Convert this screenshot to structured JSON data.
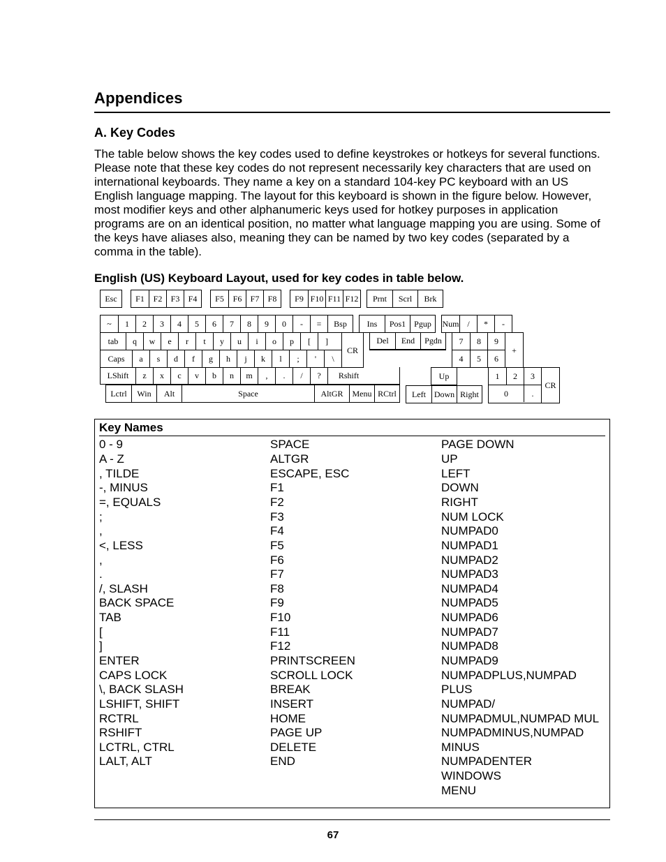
{
  "headings": {
    "appendices": "Appendices",
    "section_a": "A. Key Codes"
  },
  "intro": "The table below shows the key codes used to define keystrokes or hotkeys for several functions. Please note that these key codes do not represent necessarily key characters that are used on international keyboards. They name a key on a standard 104-key PC keyboard with an US English language mapping. The layout for this keyboard is shown in the figure below. However, most modifier keys and other alphanumeric keys used for hotkey purposes in application programs are on an identical position, no matter what language mapping you are using. Some of the keys have aliases also, meaning they can be named by two key codes (separated by a comma in the table).",
  "caption": "English (US) Keyboard Layout, used for key codes in table below.",
  "keyboard": {
    "row_fn_a": [
      "Esc"
    ],
    "row_fn_b": [
      "F1",
      "F2",
      "F3",
      "F4"
    ],
    "row_fn_c": [
      "F5",
      "F6",
      "F7",
      "F8"
    ],
    "row_fn_d": [
      "F9",
      "F10",
      "F11",
      "F12"
    ],
    "row_fn_e": [
      "Prnt",
      "Scrl",
      "Brk"
    ],
    "row_num_main": [
      "~",
      "1",
      "2",
      "3",
      "4",
      "5",
      "6",
      "7",
      "8",
      "9",
      "0",
      "-",
      "=",
      "Bsp"
    ],
    "row_num_nav": [
      "Ins",
      "Pos1",
      "Pgup"
    ],
    "row_num_npA": [
      "Num",
      "/",
      "*",
      "-"
    ],
    "row_q_main": [
      "tab",
      "q",
      "w",
      "e",
      "r",
      "t",
      "y",
      "u",
      "i",
      "o",
      "p",
      "[",
      "]"
    ],
    "enter_label": "CR",
    "row_q_nav": [
      "Del",
      "End",
      "Pgdn"
    ],
    "row_q_np": [
      "7",
      "8",
      "9"
    ],
    "np_plus": "+",
    "row_a_main": [
      "Caps",
      "a",
      "s",
      "d",
      "f",
      "g",
      "h",
      "j",
      "k",
      "l",
      ";",
      "'",
      "\\"
    ],
    "row_a_np": [
      "4",
      "5",
      "6"
    ],
    "row_z_main": [
      "LShift",
      "z",
      "x",
      "c",
      "v",
      "b",
      "n",
      "m",
      ",",
      ".",
      "/",
      "?",
      "Rshift"
    ],
    "row_z_navA": [
      "Up"
    ],
    "row_z_np": [
      "1",
      "2",
      "3"
    ],
    "np_enter": "CR",
    "row_sp_main": [
      "Lctrl",
      "Win",
      "Alt",
      "Space",
      "AltGR",
      "Menu",
      "RCtrl"
    ],
    "row_sp_nav": [
      "Left",
      "Down",
      "Right"
    ],
    "row_sp_np": [
      "0",
      "."
    ]
  },
  "keynames": {
    "title": "Key Names",
    "col1": [
      "0 - 9",
      "A - Z",
      ", TILDE",
      "-, MINUS",
      "=, EQUALS",
      ";",
      ",",
      "<, LESS",
      ",",
      ".",
      "/, SLASH",
      "BACK SPACE",
      "TAB",
      "[",
      "]",
      "ENTER",
      "CAPS LOCK",
      "\\, BACK SLASH",
      "LSHIFT, SHIFT",
      "RCTRL",
      "RSHIFT",
      "LCTRL, CTRL",
      "LALT, ALT"
    ],
    "col2": [
      "SPACE",
      "ALTGR",
      "ESCAPE, ESC",
      "F1",
      "F2",
      "F3",
      "F4",
      "F5",
      "F6",
      "F7",
      "F8",
      "F9",
      "F10",
      "F11",
      "F12",
      "PRINTSCREEN",
      "SCROLL LOCK",
      "BREAK",
      "INSERT",
      "HOME",
      "PAGE UP",
      "DELETE",
      "END"
    ],
    "col3": [
      "PAGE DOWN",
      "UP",
      "LEFT",
      "DOWN",
      "RIGHT",
      "NUM LOCK",
      "NUMPAD0",
      "NUMPAD1",
      "NUMPAD2",
      "NUMPAD3",
      "NUMPAD4",
      "NUMPAD5",
      "NUMPAD6",
      "NUMPAD7",
      "NUMPAD8",
      "NUMPAD9",
      "NUMPADPLUS,NUMPAD PLUS",
      "NUMPAD/",
      "NUMPADMUL,NUMPAD MUL",
      "NUMPADMINUS,NUMPAD MINUS",
      "NUMPADENTER",
      "WINDOWS",
      "MENU"
    ]
  },
  "page_number": "67"
}
